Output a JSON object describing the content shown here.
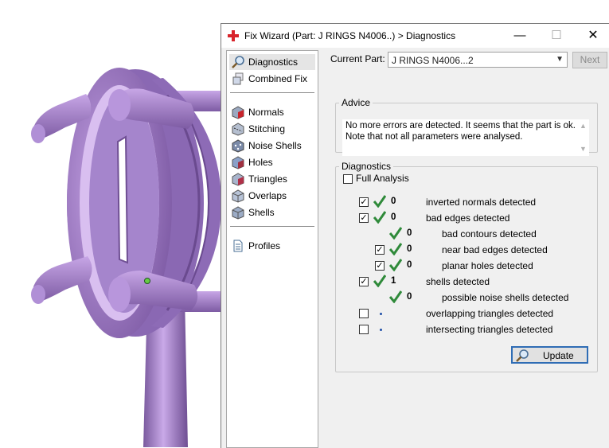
{
  "window": {
    "title": "Fix Wizard (Part: J RINGS N4006..) > Diagnostics",
    "minimize_glyph": "—",
    "maximize_glyph": "☐",
    "close_glyph": "✕"
  },
  "nav": {
    "items": [
      {
        "label": "Diagnostics",
        "icon": "magnifier-icon",
        "selected": true
      },
      {
        "label": "Combined Fix",
        "icon": "cube-stack-icon"
      },
      {
        "label": "Normals",
        "icon": "cube-normals-icon"
      },
      {
        "label": "Stitching",
        "icon": "cube-stitch-icon"
      },
      {
        "label": "Noise Shells",
        "icon": "noise-dice-icon"
      },
      {
        "label": "Holes",
        "icon": "cube-holes-icon"
      },
      {
        "label": "Triangles",
        "icon": "cube-triangles-icon"
      },
      {
        "label": "Overlaps",
        "icon": "cube-overlaps-icon"
      },
      {
        "label": "Shells",
        "icon": "cube-shells-icon"
      },
      {
        "label": "Profiles",
        "icon": "document-icon"
      }
    ]
  },
  "current_part": {
    "label": "Current Part:",
    "value": "J RINGS N4006...2",
    "next_label": "Next"
  },
  "advice": {
    "legend": "Advice",
    "line1": "No more errors are detected. It seems that the part is ok.",
    "line2": "Note that not all parameters were analysed."
  },
  "diagnostics": {
    "legend": "Diagnostics",
    "full_analysis_label": "Full Analysis",
    "full_analysis_checked": false,
    "rows": [
      {
        "checkbox": true,
        "checked": true,
        "status": "ok",
        "count": "0",
        "label": "inverted normals detected"
      },
      {
        "checkbox": true,
        "checked": true,
        "status": "ok",
        "count": "0",
        "label": "bad edges detected"
      },
      {
        "checkbox": false,
        "status": "ok",
        "count": "0",
        "label": "bad contours detected"
      },
      {
        "checkbox": true,
        "checked": true,
        "status": "ok",
        "count": "0",
        "label": "near bad edges detected"
      },
      {
        "checkbox": true,
        "checked": true,
        "status": "ok",
        "count": "0",
        "label": "planar holes detected"
      },
      {
        "checkbox": true,
        "checked": true,
        "status": "ok",
        "count": "1",
        "label": "shells detected"
      },
      {
        "checkbox": false,
        "status": "ok",
        "count": "0",
        "label": "possible noise shells detected"
      },
      {
        "checkbox": true,
        "checked": false,
        "status": "unknown",
        "count": "",
        "label": "overlapping triangles detected"
      },
      {
        "checkbox": true,
        "checked": false,
        "status": "unknown",
        "count": "",
        "label": "intersecting triangles detected"
      }
    ],
    "update_label": "Update"
  },
  "colors": {
    "model_purple": "#9b79c2",
    "check_green": "#2f8a3a",
    "accent_blue": "#2f6db5",
    "title_icon_red": "#d8242b"
  }
}
